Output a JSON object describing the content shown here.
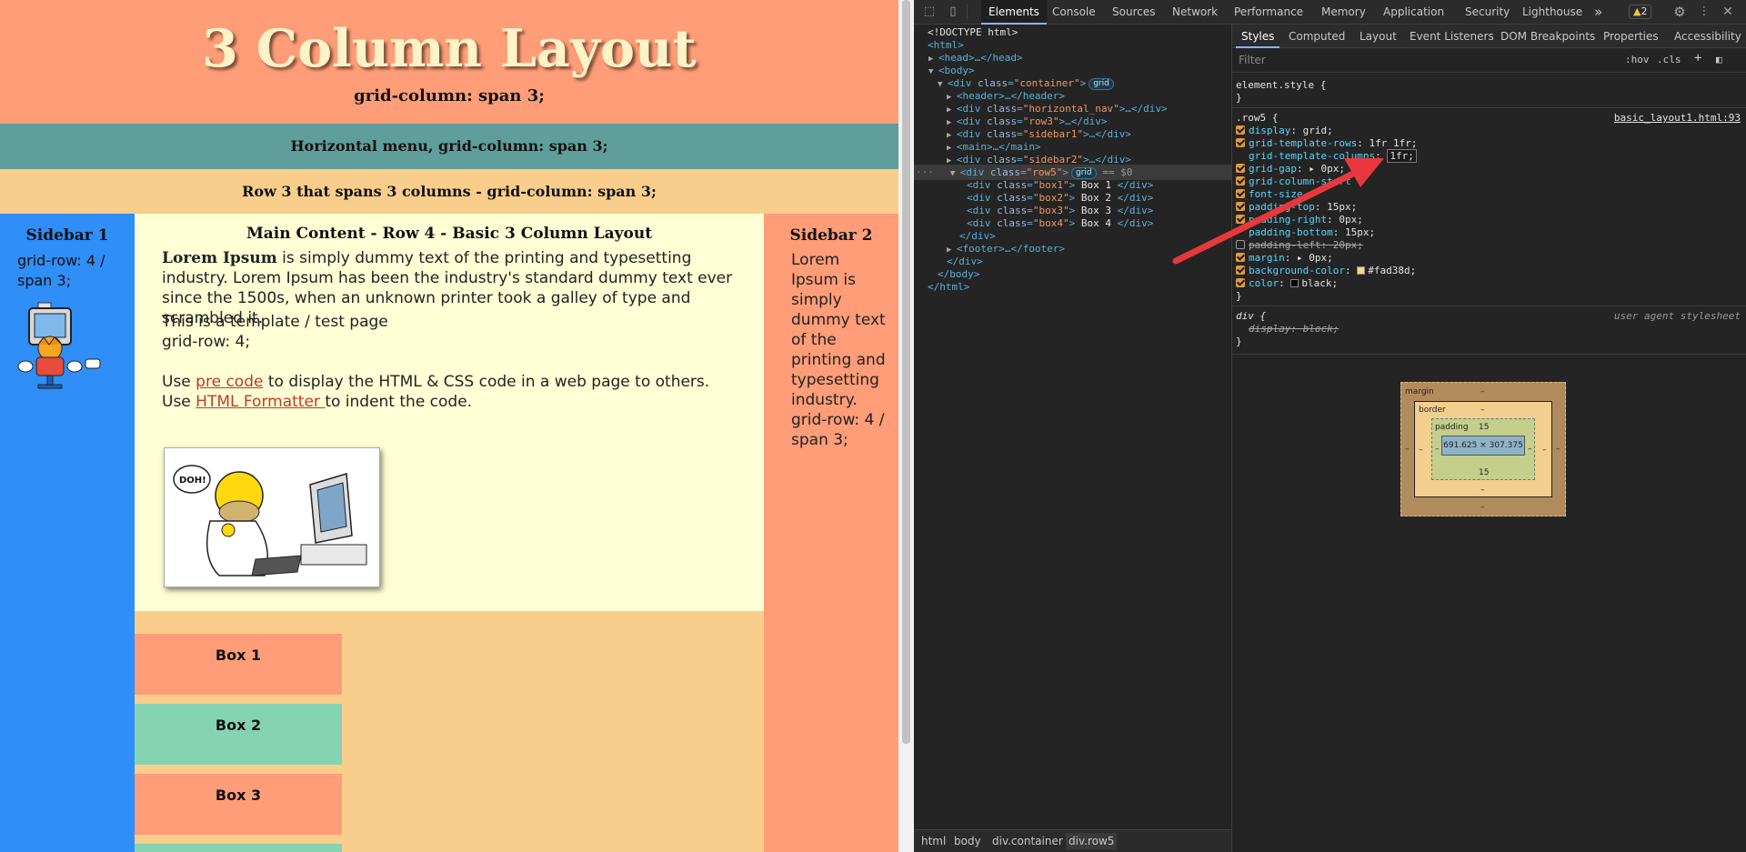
{
  "page": {
    "header_title": "3 Column Layout",
    "header_sub": "grid-column: span 3;",
    "nav_text": "Horizontal menu, grid-column: span 3;",
    "row3_text": "Row 3 that spans 3 columns - grid-column: span 3;",
    "sidebar1": {
      "title": "Sidebar 1",
      "text": "grid-row: 4 / span 3;"
    },
    "main": {
      "title": "Main Content - Row 4 - Basic 3 Column Layout",
      "lorem_bold": "Lorem Ipsum",
      "lorem_rest": " is simply dummy text of the printing and typesetting industry. Lorem Ipsum has been the industry's standard dummy text ever since the 1500s, when an unknown printer took a galley of type and scrambled it.",
      "template_heading": "This is a template / test page",
      "grid_row": "grid-row: 4;",
      "use1_pre": "Use ",
      "use1_link": "pre code",
      "use1_post": " to display the HTML & CSS code in a web page to others.",
      "use2_pre": "Use ",
      "use2_link": "HTML Formatter ",
      "use2_post": "to indent the code.",
      "doh": "DOH!"
    },
    "sidebar2": {
      "title": "Sidebar 2",
      "text": "Lorem Ipsum is simply dummy text of the printing and typesetting industry. grid-row: 4 / span 3;"
    },
    "boxes": [
      "Box 1",
      "Box 2",
      "Box 3"
    ],
    "colors": {
      "header": "#fe9d78",
      "nav": "#5f9e9a",
      "row3": "#f9cd8b",
      "sidebar1": "#2f8ef7",
      "main": "#ffffd6",
      "box_salmon": "#fe9d78",
      "box_mint": "#86d3b4"
    }
  },
  "devtools": {
    "tabs": [
      "Elements",
      "Console",
      "Sources",
      "Network",
      "Performance",
      "Memory",
      "Application",
      "Security",
      "Lighthouse"
    ],
    "more": "»",
    "warnings": "2",
    "dom": {
      "doctype": "<!DOCTYPE html>",
      "html_open": "<html>",
      "head": "<head>…</head>",
      "body_open": "<body>",
      "container": "container",
      "grid_badge": "grid",
      "header": "<header>…</header>",
      "nav_cls": "horizontal_nav",
      "row3_cls": "row3",
      "sidebar1_cls": "sidebar1",
      "main": "<main>…</main>",
      "sidebar2_cls": "sidebar2",
      "row5_cls": "row5",
      "eq0": "== $0",
      "boxes": [
        {
          "cls": "box1",
          "text": " Box 1 "
        },
        {
          "cls": "box2",
          "text": " Box 2 "
        },
        {
          "cls": "box3",
          "text": " Box 3 "
        },
        {
          "cls": "box4",
          "text": " Box 4 "
        }
      ],
      "div_close": "</div>",
      "footer": "<footer>…</footer>",
      "body_close": "</body>",
      "html_close": "</html>"
    },
    "breadcrumbs": [
      "html",
      "body",
      "div.container",
      "div.row5"
    ],
    "styles_tabs": [
      "Styles",
      "Computed",
      "Layout",
      "Event Listeners",
      "DOM Breakpoints",
      "Properties",
      "Accessibility"
    ],
    "filter_placeholder": "Filter",
    "hov": ":hov",
    "cls": ".cls",
    "element_style": "element.style {",
    "brace_close": "}",
    "rule_selector": ".row5 {",
    "rule_source": "basic_layout1.html:93",
    "declarations": [
      {
        "prop": "display",
        "val": "grid;",
        "on": true
      },
      {
        "prop": "grid-template-rows",
        "val": "1fr 1fr;",
        "on": true
      },
      {
        "prop": "grid-template-columns",
        "val": "1fr;",
        "on": false,
        "editing": true
      },
      {
        "prop": "grid-gap",
        "val": "▸ 0px;",
        "on": true
      },
      {
        "prop": "grid-column-start",
        "val": "",
        "on": true
      },
      {
        "prop": "font-size",
        "val": "",
        "on": true
      },
      {
        "prop": "padding-top",
        "val": "15px;",
        "on": true
      },
      {
        "prop": "padding-right",
        "val": "0px;",
        "on": true
      },
      {
        "prop": "padding-bottom",
        "val": "15px;",
        "on": true
      },
      {
        "prop": "padding-left",
        "val": "20px;",
        "on": false,
        "strike": true
      },
      {
        "prop": "margin",
        "val": "▸ 0px;",
        "on": true
      },
      {
        "prop": "background-color",
        "val": "#fad38d;",
        "on": true,
        "swatch": "#fad38d"
      },
      {
        "prop": "color",
        "val": "black;",
        "on": true,
        "swatch": "#000000"
      }
    ],
    "ua_selector": "div {",
    "ua_label": "user agent stylesheet",
    "ua_decl": "display: block;",
    "boxmodel": {
      "margin_label": "margin",
      "border_label": "border",
      "padding_label": "padding",
      "padding_top": "15",
      "padding_bottom": "15",
      "content_size": "691.625 × 307.375",
      "dash": "–"
    }
  }
}
